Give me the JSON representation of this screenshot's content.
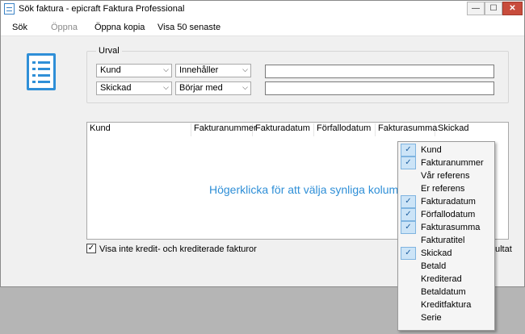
{
  "window": {
    "title": "Sök faktura - epicraft Faktura Professional"
  },
  "window_buttons": {
    "minimize": "—",
    "maximize": "☐",
    "close": "✕"
  },
  "menu": [
    "Sök",
    "Öppna",
    "Öppna kopia",
    "Visa 50 senaste"
  ],
  "urval": {
    "label": "Urval",
    "row1": {
      "field": "Kund",
      "operator": "Innehåller",
      "value": ""
    },
    "row2": {
      "field": "Skickad",
      "operator": "Börjar med",
      "value": ""
    }
  },
  "columns": [
    "Kund",
    "Fakturanummer",
    "Fakturadatum",
    "Förfallodatum",
    "Fakturasumma",
    "Skickad"
  ],
  "hint": "Högerklicka för att välja synliga kolumner",
  "exclude_credit": {
    "label": "Visa inte kredit- och krediterade fakturor",
    "checked": true
  },
  "partial_text": "ultat",
  "context_menu": [
    {
      "label": "Kund",
      "checked": true
    },
    {
      "label": "Fakturanummer",
      "checked": true
    },
    {
      "label": "Vår referens",
      "checked": false
    },
    {
      "label": "Er referens",
      "checked": false
    },
    {
      "label": "Fakturadatum",
      "checked": true
    },
    {
      "label": "Förfallodatum",
      "checked": true
    },
    {
      "label": "Fakturasumma",
      "checked": true
    },
    {
      "label": "Fakturatitel",
      "checked": false
    },
    {
      "label": "Skickad",
      "checked": true
    },
    {
      "label": "Betald",
      "checked": false
    },
    {
      "label": "Krediterad",
      "checked": false
    },
    {
      "label": "Betaldatum",
      "checked": false
    },
    {
      "label": "Kreditfaktura",
      "checked": false
    },
    {
      "label": "Serie",
      "checked": false
    }
  ],
  "colors": {
    "accent": "#2f8fd7",
    "menu_highlight": "#cce4f7"
  }
}
